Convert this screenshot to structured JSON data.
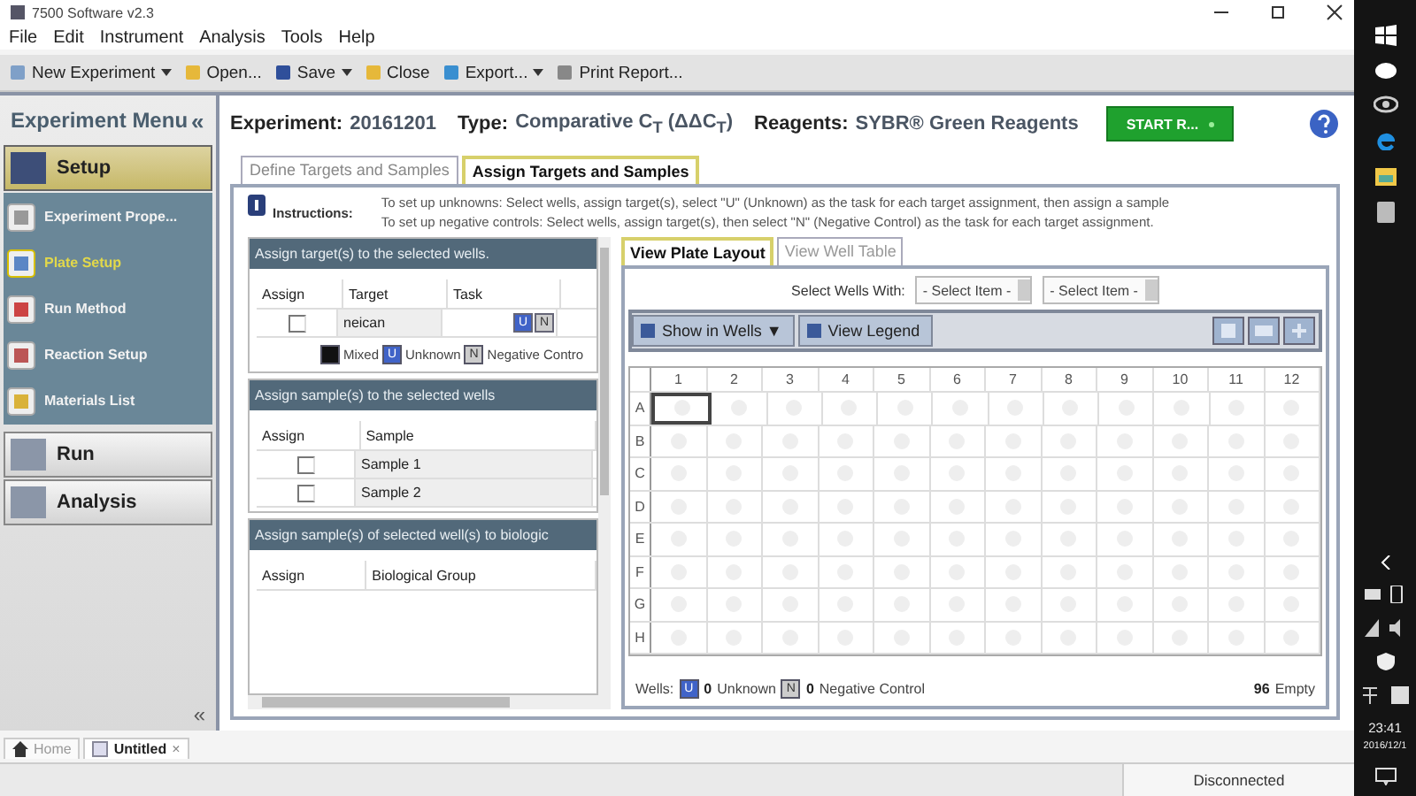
{
  "window": {
    "title": "7500 Software v2.3"
  },
  "menu": [
    "File",
    "Edit",
    "Instrument",
    "Analysis",
    "Tools",
    "Help"
  ],
  "toolbar": [
    {
      "label": "New Experiment",
      "kind": "new",
      "dropdown": true
    },
    {
      "label": "Open...",
      "kind": "folder",
      "dropdown": false
    },
    {
      "label": "Save",
      "kind": "save",
      "dropdown": true
    },
    {
      "label": "Close",
      "kind": "folder",
      "dropdown": false
    },
    {
      "label": "Export...",
      "kind": "export",
      "dropdown": true
    },
    {
      "label": "Print Report...",
      "kind": "print",
      "dropdown": false
    }
  ],
  "sidebar": {
    "title": "Experiment Menu",
    "collapse": "«",
    "bottom_collapse": "«",
    "sections": [
      {
        "label": "Setup",
        "selected": true,
        "items": [
          {
            "label": "Experiment Prope...",
            "kind": "properties",
            "selected": false
          },
          {
            "label": "Plate Setup",
            "kind": "plate",
            "selected": true
          },
          {
            "label": "Run Method",
            "kind": "method",
            "selected": false
          },
          {
            "label": "Reaction Setup",
            "kind": "reaction",
            "selected": false
          },
          {
            "label": "Materials List",
            "kind": "materials",
            "selected": false
          }
        ]
      },
      {
        "label": "Run",
        "selected": false
      },
      {
        "label": "Analysis",
        "selected": false
      }
    ]
  },
  "header": {
    "experiment_label": "Experiment:",
    "experiment": "20161201",
    "type_label": "Type:",
    "type": "Comparative C$_{T}$ (ΔΔC$_{T}$)",
    "reagents_label": "Reagents:",
    "reagents": "SYBR® Green Reagents",
    "start_button": "START R..."
  },
  "tabs": [
    {
      "label": "Define Targets and Samples",
      "selected": false
    },
    {
      "label": "Assign Targets and Samples",
      "selected": true
    }
  ],
  "instructions": {
    "label": "Instructions:",
    "lines": [
      "To set up unknowns: Select wells, assign target(s), select \"U\" (Unknown) as the task for each target assignment, then assign a sample",
      "To set up negative controls: Select wells, assign target(s), then select \"N\" (Negative Control) as the task for each target assignment."
    ]
  },
  "targets": {
    "title": "Assign target(s) to the selected wells.",
    "columns": [
      "Assign",
      "Target",
      "Task"
    ],
    "rows": [
      {
        "checked": false,
        "target": "neican",
        "tasks": [
          {
            "label": "U",
            "kind": "unknown"
          },
          {
            "label": "N",
            "kind": "negative"
          }
        ]
      }
    ],
    "legend": [
      {
        "label": "Mixed",
        "kind": "mixed"
      },
      {
        "label": "Unknown",
        "kind": "unknown",
        "icon": "U"
      },
      {
        "label": "Negative Contro",
        "kind": "negative",
        "icon": "N"
      }
    ]
  },
  "samples": {
    "title": "Assign sample(s) to the selected wells",
    "columns": [
      "Assign",
      "Sample"
    ],
    "rows": [
      {
        "checked": false,
        "sample": "Sample 1"
      },
      {
        "checked": false,
        "sample": "Sample 2"
      }
    ]
  },
  "groups": {
    "title": "Assign sample(s) of selected well(s) to biologic",
    "columns": [
      "Assign",
      "Biological Group"
    ]
  },
  "plate": {
    "tabs": [
      {
        "label": "View Plate Layout",
        "selected": true
      },
      {
        "label": "View Well Table",
        "selected": false
      }
    ],
    "select_label": "Select Wells With:",
    "selects": [
      "- Select Item -",
      "- Select Item -"
    ],
    "show_button": "Show in Wells ▼",
    "legend_button": "View Legend",
    "columns": [
      "1",
      "2",
      "3",
      "4",
      "5",
      "6",
      "7",
      "8",
      "9",
      "10",
      "11",
      "12"
    ],
    "rows": [
      {
        "label": "A",
        "selected": [
          true,
          false,
          false,
          false,
          false,
          false,
          false,
          false,
          false,
          false,
          false,
          false
        ]
      },
      {
        "label": "B",
        "selected": [
          false,
          false,
          false,
          false,
          false,
          false,
          false,
          false,
          false,
          false,
          false,
          false
        ]
      },
      {
        "label": "C",
        "selected": [
          false,
          false,
          false,
          false,
          false,
          false,
          false,
          false,
          false,
          false,
          false,
          false
        ]
      },
      {
        "label": "D",
        "selected": [
          false,
          false,
          false,
          false,
          false,
          false,
          false,
          false,
          false,
          false,
          false,
          false
        ]
      },
      {
        "label": "E",
        "selected": [
          false,
          false,
          false,
          false,
          false,
          false,
          false,
          false,
          false,
          false,
          false,
          false
        ]
      },
      {
        "label": "F",
        "selected": [
          false,
          false,
          false,
          false,
          false,
          false,
          false,
          false,
          false,
          false,
          false,
          false
        ]
      },
      {
        "label": "G",
        "selected": [
          false,
          false,
          false,
          false,
          false,
          false,
          false,
          false,
          false,
          false,
          false,
          false
        ]
      },
      {
        "label": "H",
        "selected": [
          false,
          false,
          false,
          false,
          false,
          false,
          false,
          false,
          false,
          false,
          false,
          false
        ]
      }
    ],
    "footer": {
      "label": "Wells:",
      "counts": [
        {
          "count": "0",
          "label": "Unknown",
          "kind": "unknown",
          "icon": "U"
        },
        {
          "count": "0",
          "label": "Negative Control",
          "kind": "negative",
          "icon": "N"
        }
      ],
      "empty_count": "96",
      "empty_label": "Empty"
    }
  },
  "bottom_tabs": [
    {
      "label": "Home",
      "kind": "home",
      "selected": false,
      "closable": false
    },
    {
      "label": "Untitled",
      "kind": "document",
      "selected": true,
      "closable": true
    }
  ],
  "close_mark": "×",
  "status": "Disconnected",
  "taskbar": {
    "time": "23:41",
    "date": "2016/12/1"
  }
}
